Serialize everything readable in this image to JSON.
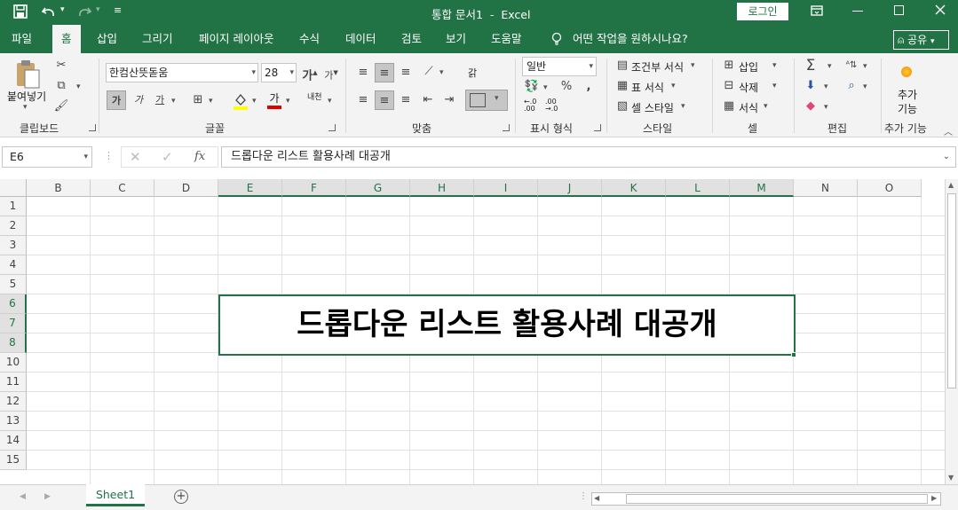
{
  "title": {
    "doc_name": "통합 문서1  -  Excel",
    "login_label": "로그인"
  },
  "tabs": [
    "파일",
    "홈",
    "삽입",
    "그리기",
    "페이지 레이아웃",
    "수식",
    "데이터",
    "검토",
    "보기",
    "도움말"
  ],
  "tell_me": "어떤 작업을 원하시나요?",
  "share_label": "공유",
  "ribbon": {
    "clipboard": {
      "paste": "붙여넣기",
      "label": "클립보드"
    },
    "font": {
      "name": "한컴산뜻돋움",
      "size": "28",
      "bold": "가",
      "italic": "가",
      "underline": "가",
      "grow": "가",
      "shrink": "가",
      "color_glyph": "가",
      "phonetic": "내천",
      "label": "글꼴"
    },
    "align": {
      "label": "맞춤",
      "wrap_glyph": "갉"
    },
    "number": {
      "format": "일반",
      "label": "표시 형식"
    },
    "styles": {
      "conditional": "조건부 서식",
      "table": "표 서식",
      "cell": "셀 스타일",
      "label": "스타일"
    },
    "cells": {
      "insert": "삽입",
      "delete": "삭제",
      "format": "서식",
      "label": "셀"
    },
    "editing": {
      "label": "편집"
    },
    "addins": {
      "btn": "추가 기능",
      "label": "추가 기능"
    }
  },
  "formula": {
    "name_box": "E6",
    "content": "드롭다운 리스트 활용사례 대공개"
  },
  "columns": [
    "B",
    "C",
    "D",
    "E",
    "F",
    "G",
    "H",
    "I",
    "J",
    "K",
    "L",
    "M",
    "N",
    "O"
  ],
  "rows": [
    "1",
    "2",
    "3",
    "4",
    "5",
    "6",
    "7",
    "8",
    "10",
    "11",
    "12",
    "13",
    "14",
    "15"
  ],
  "merged_cell_text": "드롭다운 리스트 활용사례 대공개",
  "sheet_tab": "Sheet1",
  "accent_color": "#217346"
}
